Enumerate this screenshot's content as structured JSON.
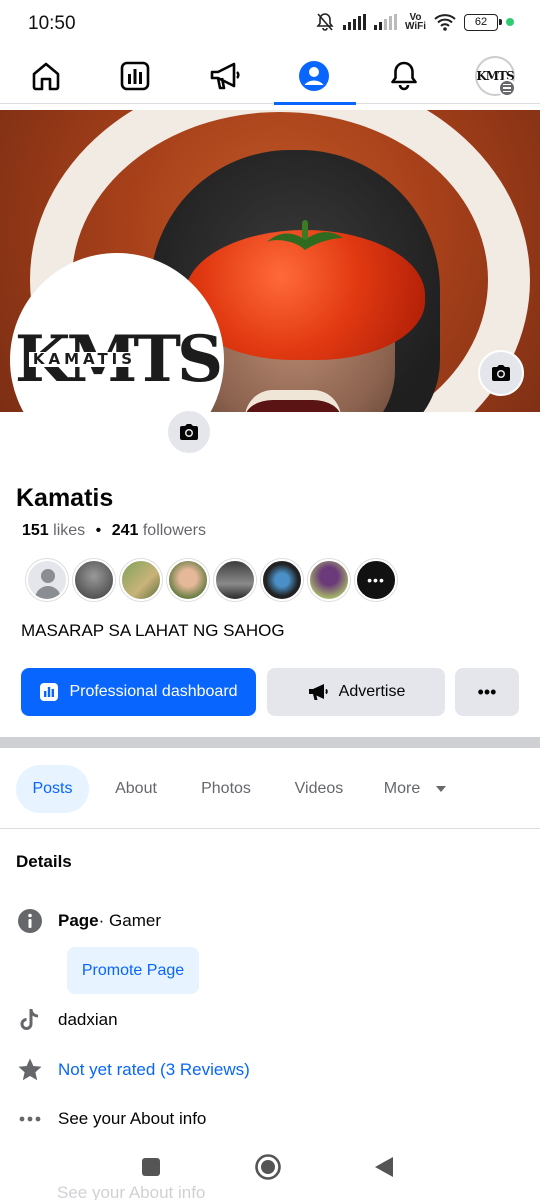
{
  "status_bar": {
    "time": "10:50",
    "vowifi_top": "Vo",
    "vowifi_bottom": "WiFi",
    "battery": "62"
  },
  "nav": {
    "tabs": [
      {
        "name": "home"
      },
      {
        "name": "dashboard"
      },
      {
        "name": "ads"
      },
      {
        "name": "profile",
        "active": true
      },
      {
        "name": "notifications"
      },
      {
        "name": "page-menu"
      }
    ],
    "avatar_label": "KMTS"
  },
  "profile": {
    "logo_main": "KMTS",
    "logo_sub": "KAMATIS",
    "name": "Kamatis",
    "likes_count": "151",
    "likes_label": "likes",
    "separator": "•",
    "followers_count": "241",
    "followers_label": "followers",
    "bio": "MASARAP SA LAHAT NG SAHOG",
    "more_avatars_label": "•••"
  },
  "actions": {
    "pro_dashboard": "Professional dashboard",
    "advertise": "Advertise",
    "more": "•••"
  },
  "tabs": [
    {
      "label": "Posts",
      "active": true
    },
    {
      "label": "About"
    },
    {
      "label": "Photos"
    },
    {
      "label": "Videos"
    },
    {
      "label": "More"
    }
  ],
  "details": {
    "title": "Details",
    "page_label": "Page",
    "category": " · Gamer",
    "promote": "Promote Page",
    "tiktok": "dadxian",
    "rating": "Not yet rated (3 Reviews)",
    "about_info": "See your About info",
    "ghost_text": "See your About info"
  },
  "colors": {
    "accent": "#0866ff",
    "light_accent": "#e7f3ff",
    "grey_button": "#e4e6eb"
  }
}
